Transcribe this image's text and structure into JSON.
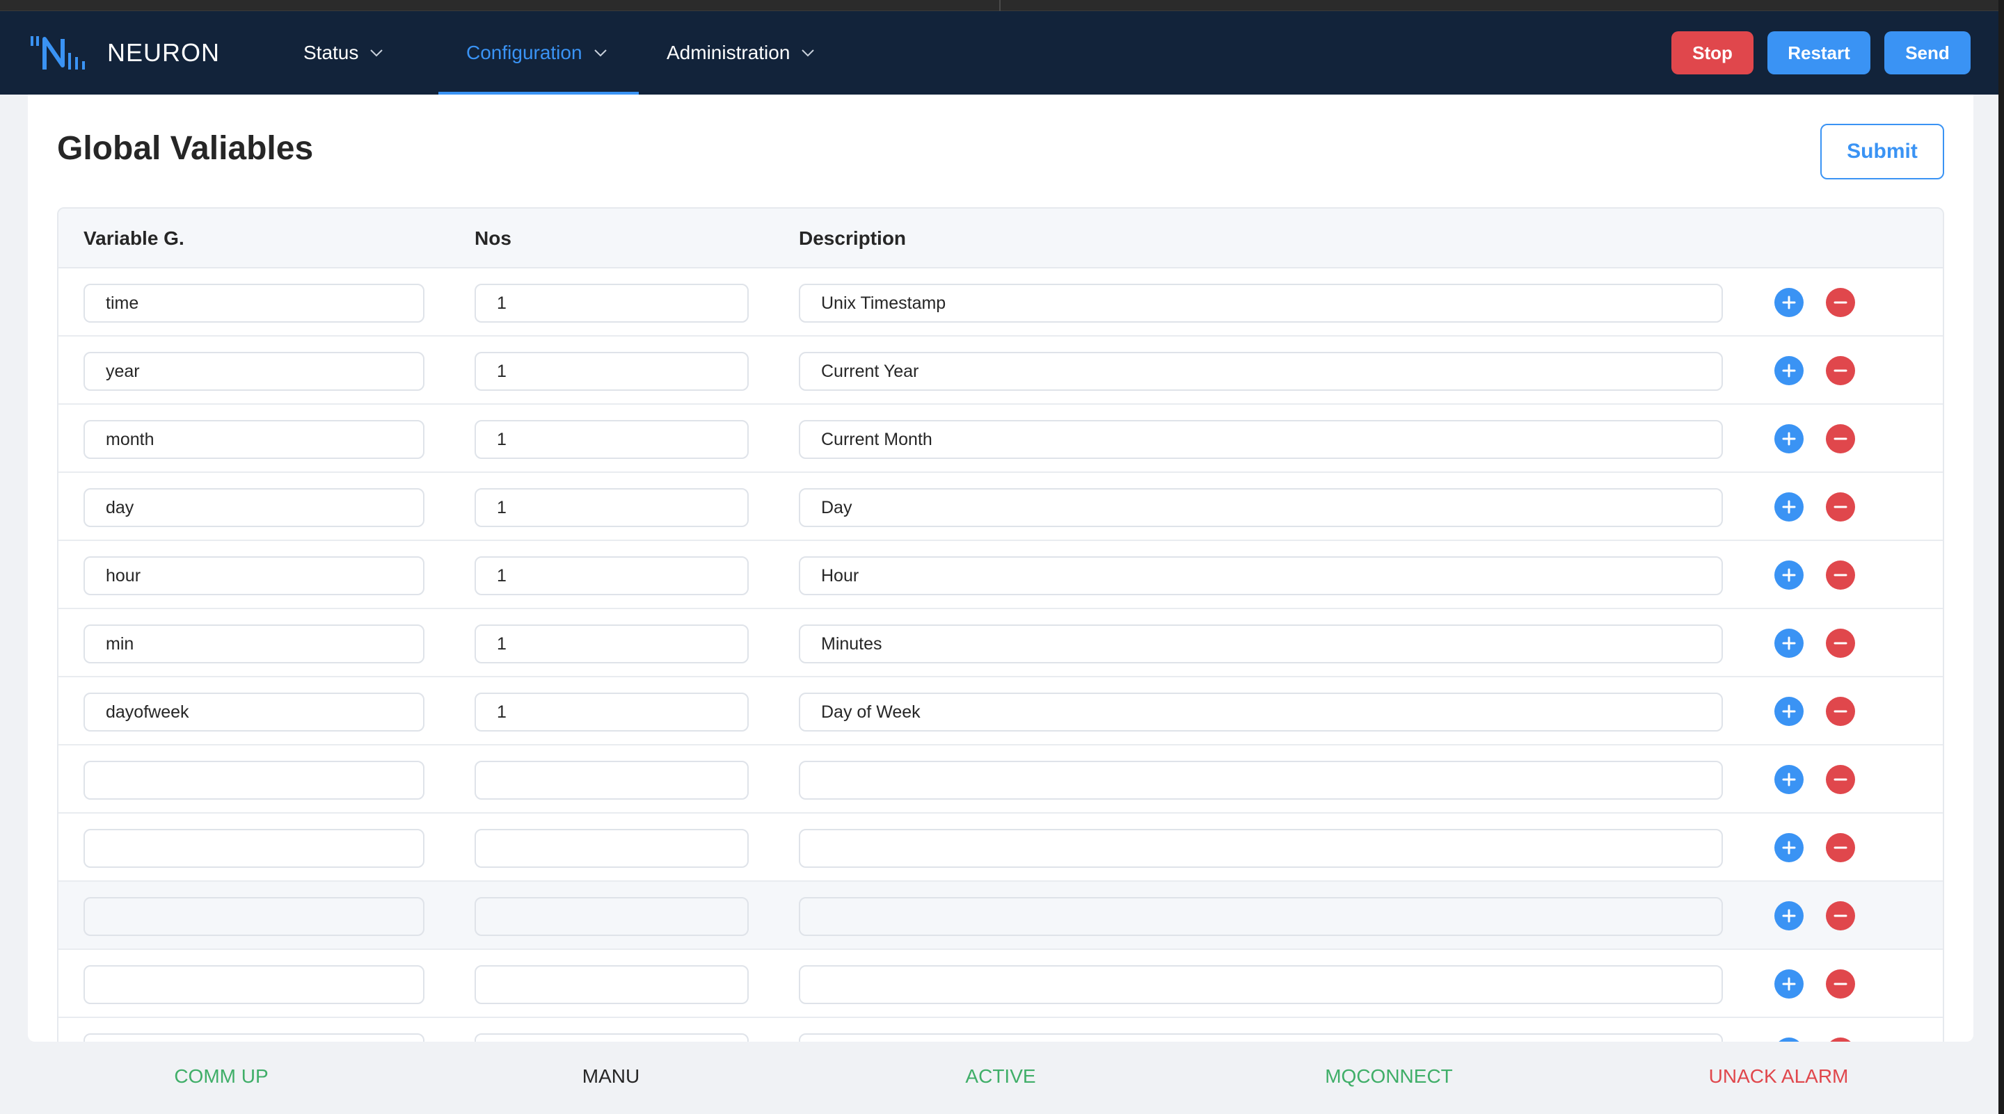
{
  "app": {
    "logo_text": "NEURON",
    "accent_color": "#3a93f4",
    "danger_color": "#e0474c",
    "header_bg": "#12233a"
  },
  "nav": {
    "status": "Status",
    "configuration": "Configuration",
    "administration": "Administration"
  },
  "header_buttons": {
    "stop": "Stop",
    "restart": "Restart",
    "send": "Send"
  },
  "page": {
    "title": "Global Valiables",
    "submit": "Submit"
  },
  "table": {
    "columns": [
      "Variable G.",
      "Nos",
      "Description"
    ],
    "rows": [
      {
        "variable": "time",
        "nos": "1",
        "description": "Unix Timestamp"
      },
      {
        "variable": "year",
        "nos": "1",
        "description": "Current Year"
      },
      {
        "variable": "month",
        "nos": "1",
        "description": "Current Month"
      },
      {
        "variable": "day",
        "nos": "1",
        "description": "Day"
      },
      {
        "variable": "hour",
        "nos": "1",
        "description": "Hour"
      },
      {
        "variable": "min",
        "nos": "1",
        "description": "Minutes"
      },
      {
        "variable": "dayofweek",
        "nos": "1",
        "description": "Day of Week"
      },
      {
        "variable": "",
        "nos": "",
        "description": ""
      },
      {
        "variable": "",
        "nos": "",
        "description": ""
      },
      {
        "variable": "",
        "nos": "",
        "description": ""
      },
      {
        "variable": "",
        "nos": "",
        "description": ""
      },
      {
        "variable": "",
        "nos": "",
        "description": ""
      }
    ]
  },
  "statusbar": {
    "comm": "COMM UP",
    "manu": "MANU",
    "active": "ACTIVE",
    "mqconnect": "MQCONNECT",
    "alarm": "UNACK ALARM"
  }
}
